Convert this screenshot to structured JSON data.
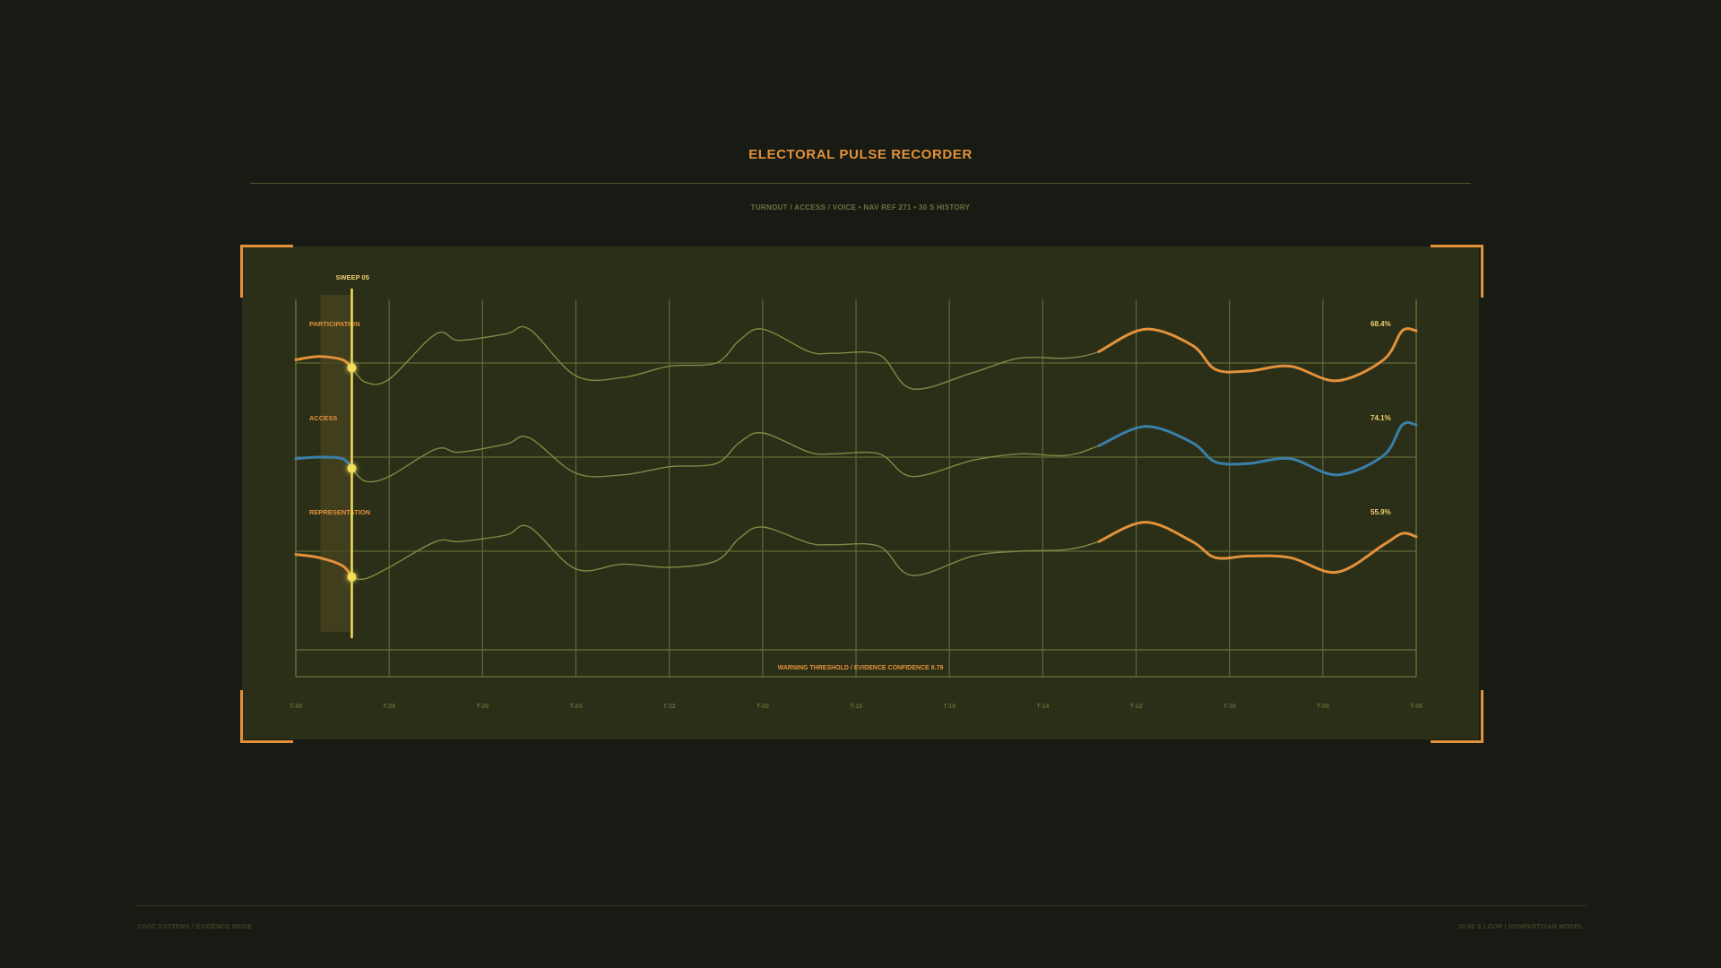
{
  "header": {
    "title": "ELECTORAL PULSE RECORDER",
    "subtitle": "TURNOUT / ACCESS / VOICE  •  NAV REF 271  •  30 S HISTORY"
  },
  "footer": {
    "left": "CIVIC SYSTEMS / EVIDENCE MODE",
    "right": "30.00 S LOOP / NONPARTISAN MODEL"
  },
  "colors": {
    "accent": "#e3913a",
    "sweep": "#f2de5a",
    "blue": "#3a7fa8",
    "grid": "#5f6a35",
    "trace_dim": "#7f8a45",
    "panel": "#2b2f18",
    "background": "#181b13"
  },
  "chart_data": {
    "type": "line",
    "title": "ELECTORAL PULSE RECORDER",
    "x_ticks": [
      "T-30",
      "T-28",
      "T-26",
      "T-24",
      "T-22",
      "T-20",
      "T-18",
      "T-16",
      "T-14",
      "T-12",
      "T-10",
      "T-08",
      "T-06"
    ],
    "xlim": [
      -30,
      -6
    ],
    "sweep": {
      "label": "SWEEP 05",
      "x": -28.8
    },
    "threshold": {
      "label": "WARNING THRESHOLD / EVIDENCE CONFIDENCE 8.79"
    },
    "series": [
      {
        "name": "PARTICIPATION",
        "color": "#e3913a",
        "value_label": "68.4%",
        "x": [
          -30,
          -29.5,
          -29,
          -28.8,
          -28.5,
          -28,
          -27,
          -26.5,
          -25.5,
          -25,
          -24,
          -23,
          -22,
          -21,
          -20.5,
          -20,
          -19,
          -18.5,
          -17.5,
          -16.8,
          -15.5,
          -14.5,
          -13.5,
          -12.8,
          -11.8,
          -10.8,
          -10.3,
          -9.6,
          -8.7,
          -7.7,
          -6.7,
          -6.3,
          -6
        ],
        "y": [
          0.1,
          0.2,
          0.1,
          -0.15,
          -0.6,
          -0.5,
          0.9,
          0.7,
          0.9,
          1.05,
          -0.4,
          -0.45,
          -0.1,
          0,
          0.7,
          1.05,
          0.35,
          0.3,
          0.25,
          -0.8,
          -0.3,
          0.15,
          0.15,
          0.35,
          1.05,
          0.55,
          -0.2,
          -0.25,
          -0.1,
          -0.55,
          0.1,
          1.0,
          1.0
        ]
      },
      {
        "name": "ACCESS",
        "color": "#3a7fa8",
        "value_label": "74.1%",
        "x": [
          -30,
          -29.5,
          -29,
          -28.8,
          -28.5,
          -28,
          -27,
          -26.5,
          -25.5,
          -25,
          -24,
          -23,
          -22,
          -21,
          -20.5,
          -20,
          -19,
          -18.5,
          -17.5,
          -16.8,
          -15.5,
          -14.5,
          -13.5,
          -12.8,
          -11.8,
          -10.8,
          -10.3,
          -9.6,
          -8.7,
          -7.7,
          -6.7,
          -6.3,
          -6
        ],
        "y": [
          -0.05,
          0.0,
          -0.05,
          -0.35,
          -0.75,
          -0.6,
          0.25,
          0.15,
          0.4,
          0.6,
          -0.5,
          -0.55,
          -0.3,
          -0.2,
          0.45,
          0.75,
          0.15,
          0.1,
          0.1,
          -0.6,
          -0.1,
          0.1,
          0.05,
          0.35,
          0.95,
          0.45,
          -0.15,
          -0.2,
          -0.05,
          -0.55,
          0.05,
          1.0,
          1.0
        ]
      },
      {
        "name": "REPRESENTATION",
        "color": "#e3913a",
        "value_label": "55.9%",
        "x": [
          -30,
          -29.5,
          -29,
          -28.8,
          -28.5,
          -28,
          -27,
          -26.5,
          -25.5,
          -25,
          -24,
          -23,
          -22,
          -21,
          -20.5,
          -20,
          -19,
          -18.5,
          -17.5,
          -16.8,
          -15.5,
          -14.5,
          -13.5,
          -12.8,
          -11.8,
          -10.8,
          -10.3,
          -9.6,
          -8.7,
          -7.7,
          -6.7,
          -6.3,
          -6
        ],
        "y": [
          -0.1,
          -0.2,
          -0.45,
          -0.8,
          -0.85,
          -0.5,
          0.3,
          0.3,
          0.5,
          0.75,
          -0.55,
          -0.4,
          -0.5,
          -0.3,
          0.4,
          0.75,
          0.25,
          0.2,
          0.15,
          -0.75,
          -0.15,
          0.0,
          0.05,
          0.3,
          0.9,
          0.3,
          -0.2,
          -0.15,
          -0.2,
          -0.65,
          0.2,
          0.55,
          0.45
        ]
      }
    ]
  }
}
